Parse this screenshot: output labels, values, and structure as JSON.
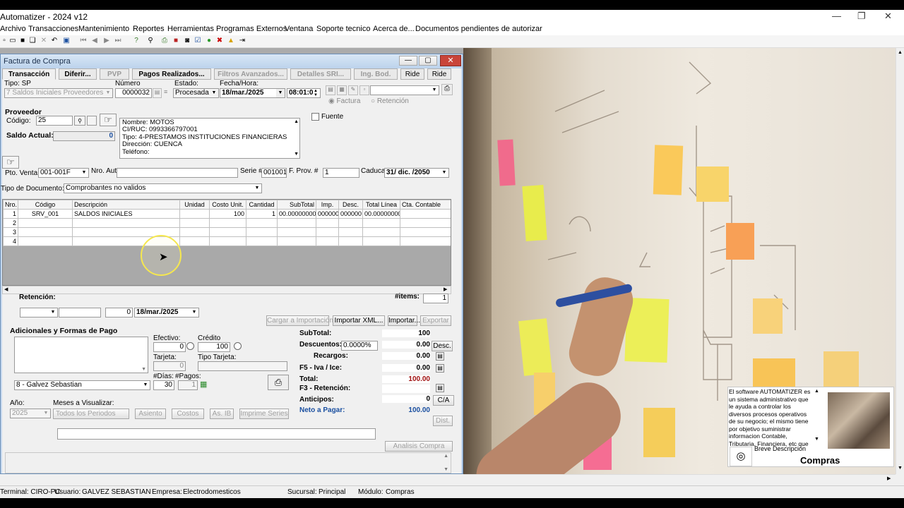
{
  "app": {
    "title": "Automatizer - 2024 v12"
  },
  "menu": [
    "Archivo",
    "Transacciones",
    "Mantenimiento",
    "Reportes",
    "Herramientas",
    "Programas Externos",
    "Ventana",
    "Soporte tecnico",
    "Acerca de...",
    "Documentos pendientes de autorizar"
  ],
  "window": {
    "title": "Factura de Compra"
  },
  "tabs": {
    "transaccion": "Transacción",
    "diferir": "Diferir...",
    "pvp": "PVP",
    "pagos": "Pagos Realizados...",
    "filtros": "Filtros Avanzados...",
    "detalles": "Detalles SRI...",
    "ingbod": "Ing. Bod.",
    "ride1": "Ride",
    "ride2": "Ride"
  },
  "header": {
    "tipo_label": "Tipo: SP",
    "tipo_value": "7 Saldos Iniciales Proveedores",
    "numero_label": "Número",
    "numero_value": "0000032",
    "estado_label": "Estado:",
    "estado_value": "Procesada",
    "fecha_label": "Fecha/Hora:",
    "fecha_value": "18/mar./2025",
    "hora_value": "08:01:0",
    "factura": "Factura",
    "retencion": "Retención"
  },
  "proveedor": {
    "heading": "Proveedor",
    "codigo_label": "Código:",
    "codigo_value": "25",
    "saldo_label": "Saldo Actual:",
    "saldo_value": "0",
    "fuente": "Fuente",
    "info": [
      "Nombre: MOTOS",
      "CI/RUC: 0993366797001",
      "Tipo: 4-PRESTAMOS INSTITUCIONES FINANCIERAS",
      "Dirección: CUENCA",
      "Teléfono:"
    ]
  },
  "doc": {
    "pto_label": "Pto. Venta:",
    "pto_value": "001-001F",
    "aut_label": "Nro. Aut.:",
    "serie_label": "Serie #",
    "serie_value": "001001",
    "fprov_label": "F. Prov. #",
    "fprov_value": "1",
    "caduca_label": "Caduca:",
    "caduca_value": "31/ dic. /2050",
    "tipodoc_label": "Tipo de Documento:",
    "tipodoc_value": "Comprobantes no validos"
  },
  "grid": {
    "columns": [
      "Nro.",
      "Código",
      "Descripción",
      "Unidad",
      "Costo Unit.",
      "Cantidad",
      "SubTotal",
      "Imp.",
      "Desc.",
      "Total Línea",
      "Cta. Contable"
    ],
    "rows": [
      [
        "1",
        "SRV_001",
        "SALDOS INICIALES",
        "",
        "100",
        "1",
        "00.00000000",
        "000000",
        "000000",
        "00.00000000",
        ""
      ],
      [
        "2",
        "",
        "",
        "",
        "",
        "",
        "",
        "",
        "",
        "",
        ""
      ],
      [
        "3",
        "",
        "",
        "",
        "",
        "",
        "",
        "",
        "",
        "",
        ""
      ],
      [
        "4",
        "",
        "",
        "",
        "",
        "",
        "",
        "",
        "",
        "",
        ""
      ]
    ],
    "items_label": "#items:",
    "items_value": "1"
  },
  "retencion": {
    "label": "Retención:",
    "num": "0",
    "fecha": "18/mar./2025"
  },
  "actions": {
    "cargar": "Cargar a Importación",
    "importar_xml": "Importar XML...",
    "importar": "Importar...",
    "exportar": "Exportar"
  },
  "pago": {
    "heading": "Adicionales y Formas de Pago",
    "efectivo_label": "Efectivo:",
    "efectivo_value": "0",
    "credito_label": "Crédito",
    "credito_value": "100",
    "tarjeta_label": "Tarjeta:",
    "tarjeta_value": "0",
    "tipo_tarjeta_label": "Tipo Tarjeta:",
    "vendedor": "8 - Galvez Sebastian",
    "dias_label": "#Días:",
    "dias_value": "30",
    "pagos_label": "#Pagos:",
    "pagos_value": "1"
  },
  "totals": {
    "subtotal_label": "SubTotal:",
    "subtotal": "100",
    "descuentos_label": "Descuentos:",
    "descuentos_pct": "0.0000%",
    "descuentos": "0.00",
    "desc_btn": "Desc.",
    "recargos_label": "Recargos:",
    "recargos": "0.00",
    "iva_label": "F5 - Iva / Ice:",
    "iva": "0.00",
    "total_label": "Total:",
    "total": "100.00",
    "ret_label": "F3 - Retención:",
    "anticipos_label": "Anticipos:",
    "anticipos": "0",
    "ca_btn": "C/A",
    "neto_label": "Neto a Pagar:",
    "neto": "100.00",
    "dist_btn": "Dist."
  },
  "footer": {
    "anio_label": "Año:",
    "anio_value": "2025",
    "meses_label": "Meses a Visualizar:",
    "meses_value": "Todos los Periodos",
    "asiento": "Asiento",
    "costos": "Costos",
    "asib": "As. IB",
    "series": "Imprime Series",
    "analisis": "Analisis Compra"
  },
  "info_panel": {
    "text": "El software AUTOMATIZER es un sistema administrativo que le ayuda a controlar los diversos procesos operativos de su negocio; el mismo tiene por objetivo suministrar informacion Contable, Tributaria, Financiera, etc que",
    "breve": "Breve Descripción",
    "title": "Compras"
  },
  "status": {
    "terminal": "Terminal: CIRO-PC",
    "usuario": "Usuario:",
    "usuario_value": "GALVEZ SEBASTIAN",
    "empresa": "Empresa:",
    "empresa_value": "Electrodomesticos",
    "sucursal": "Sucursal:",
    "sucursal_value": "Principal",
    "modulo": "Módulo:",
    "modulo_value": "Compras"
  },
  "colors": {
    "accent": "#1a4fa0",
    "close": "#c9453a",
    "highlight": "#f5e74f"
  }
}
